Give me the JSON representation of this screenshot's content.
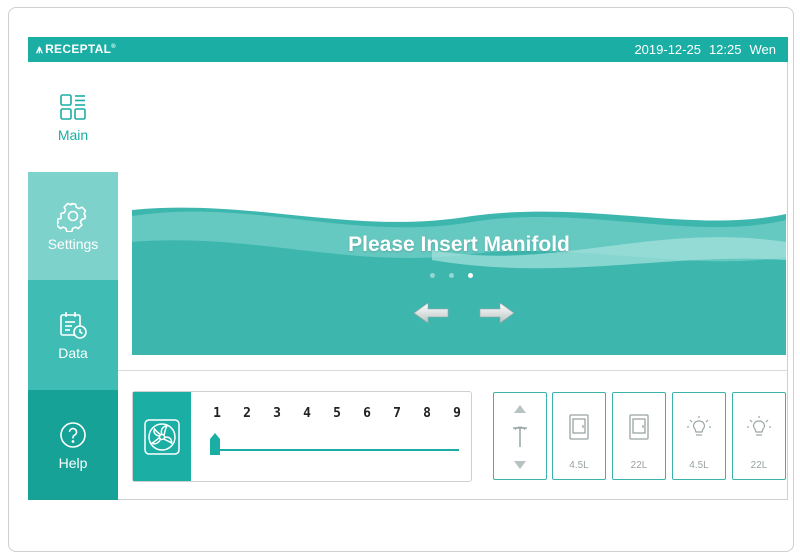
{
  "brand": {
    "logo_text": "RECEPTAL",
    "logo_mark": "⩚"
  },
  "status": {
    "date": "2019-12-25",
    "time": "12:25",
    "weekday": "Wen"
  },
  "sidebar": {
    "items": [
      {
        "label": "Main",
        "icon": "dashboard-grid-icon"
      },
      {
        "label": "Settings",
        "icon": "gear-icon"
      },
      {
        "label": "Data",
        "icon": "calendar-clock-icon"
      },
      {
        "label": "Help",
        "icon": "question-circle-icon"
      }
    ]
  },
  "banner": {
    "message": "Please Insert Manifold",
    "pager": {
      "count": 3,
      "active_index": 2
    },
    "nav": {
      "prev_icon": "arrow-left-icon",
      "next_icon": "arrow-right-icon"
    }
  },
  "fan": {
    "icon": "fan-icon",
    "speeds": [
      "1",
      "2",
      "3",
      "4",
      "5",
      "6",
      "7",
      "8",
      "9"
    ],
    "current_speed": 1
  },
  "controls": {
    "pressure_toggle": {
      "icon": "pressure-up-down-icon"
    },
    "containers": [
      {
        "label": "4.5L",
        "icon": "container-icon"
      },
      {
        "label": "22L",
        "icon": "container-icon"
      }
    ],
    "lights": [
      {
        "label": "4.5L",
        "icon": "light-bulb-icon"
      },
      {
        "label": "22L",
        "icon": "light-bulb-icon"
      }
    ]
  },
  "colors": {
    "primary": "#1aaea4",
    "settings_bg": "#7dd2cb",
    "data_bg": "#3fbdb4",
    "help_bg": "#16a297",
    "banner_bg": "#3db7ae"
  }
}
